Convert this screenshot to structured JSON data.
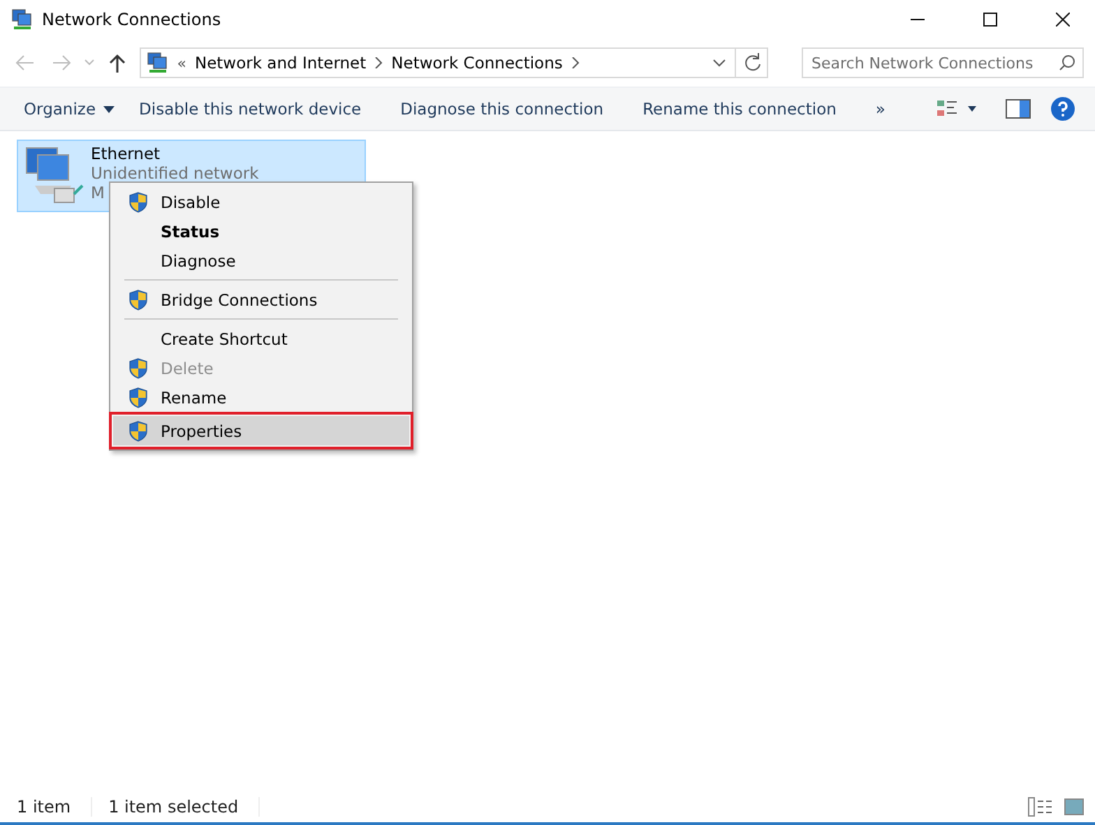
{
  "window": {
    "title": "Network Connections"
  },
  "address": {
    "overflow": "«",
    "crumbs": [
      "Network and Internet",
      "Network Connections"
    ]
  },
  "search": {
    "placeholder": "Search Network Connections"
  },
  "toolbar": {
    "items": [
      "Organize",
      "Disable this network device",
      "Diagnose this connection",
      "Rename this connection"
    ],
    "more": "»"
  },
  "connection": {
    "name": "Ethernet",
    "status": "Unidentified network",
    "device": "M",
    "selected": true
  },
  "menu": [
    {
      "kind": "item",
      "label": "Disable",
      "shield": true,
      "bold": false,
      "disabled": false,
      "selected": false
    },
    {
      "kind": "item",
      "label": "Status",
      "shield": false,
      "bold": true,
      "disabled": false,
      "selected": false
    },
    {
      "kind": "item",
      "label": "Diagnose",
      "shield": false,
      "bold": false,
      "disabled": false,
      "selected": false
    },
    {
      "kind": "separator"
    },
    {
      "kind": "item",
      "label": "Bridge Connections",
      "shield": true,
      "bold": false,
      "disabled": false,
      "selected": false
    },
    {
      "kind": "separator"
    },
    {
      "kind": "item",
      "label": "Create Shortcut",
      "shield": false,
      "bold": false,
      "disabled": false,
      "selected": false
    },
    {
      "kind": "item",
      "label": "Delete",
      "shield": true,
      "bold": false,
      "disabled": true,
      "selected": false
    },
    {
      "kind": "item",
      "label": "Rename",
      "shield": true,
      "bold": false,
      "disabled": false,
      "selected": false
    },
    {
      "kind": "item",
      "label": "Properties",
      "shield": true,
      "bold": false,
      "disabled": false,
      "selected": true
    }
  ],
  "status_bar": {
    "count": "1 item",
    "selection": "1 item selected"
  }
}
